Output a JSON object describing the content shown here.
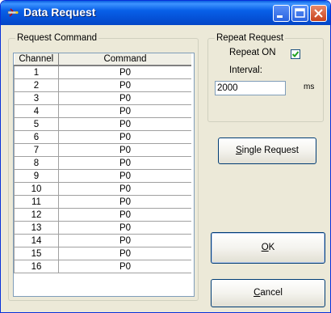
{
  "window": {
    "title": "Data Request"
  },
  "request_group": {
    "legend": "Request Command",
    "columns": [
      "Channel",
      "Command"
    ],
    "rows": [
      {
        "channel": "1",
        "command": "P0"
      },
      {
        "channel": "2",
        "command": "P0"
      },
      {
        "channel": "3",
        "command": "P0"
      },
      {
        "channel": "4",
        "command": "P0"
      },
      {
        "channel": "5",
        "command": "P0"
      },
      {
        "channel": "6",
        "command": "P0"
      },
      {
        "channel": "7",
        "command": "P0"
      },
      {
        "channel": "8",
        "command": "P0"
      },
      {
        "channel": "9",
        "command": "P0"
      },
      {
        "channel": "10",
        "command": "P0"
      },
      {
        "channel": "11",
        "command": "P0"
      },
      {
        "channel": "12",
        "command": "P0"
      },
      {
        "channel": "13",
        "command": "P0"
      },
      {
        "channel": "14",
        "command": "P0"
      },
      {
        "channel": "15",
        "command": "P0"
      },
      {
        "channel": "16",
        "command": "P0"
      }
    ]
  },
  "repeat_group": {
    "legend": "Repeat Request",
    "repeat_on_label": "Repeat ON",
    "repeat_on_checked": true,
    "interval_label": "Interval:",
    "interval_value": "2000",
    "interval_unit": "ms"
  },
  "buttons": {
    "single_request_accel": "S",
    "single_request_rest": "ingle Request",
    "ok_accel": "O",
    "ok_rest": "K",
    "cancel_accel": "C",
    "cancel_rest": "ancel"
  }
}
